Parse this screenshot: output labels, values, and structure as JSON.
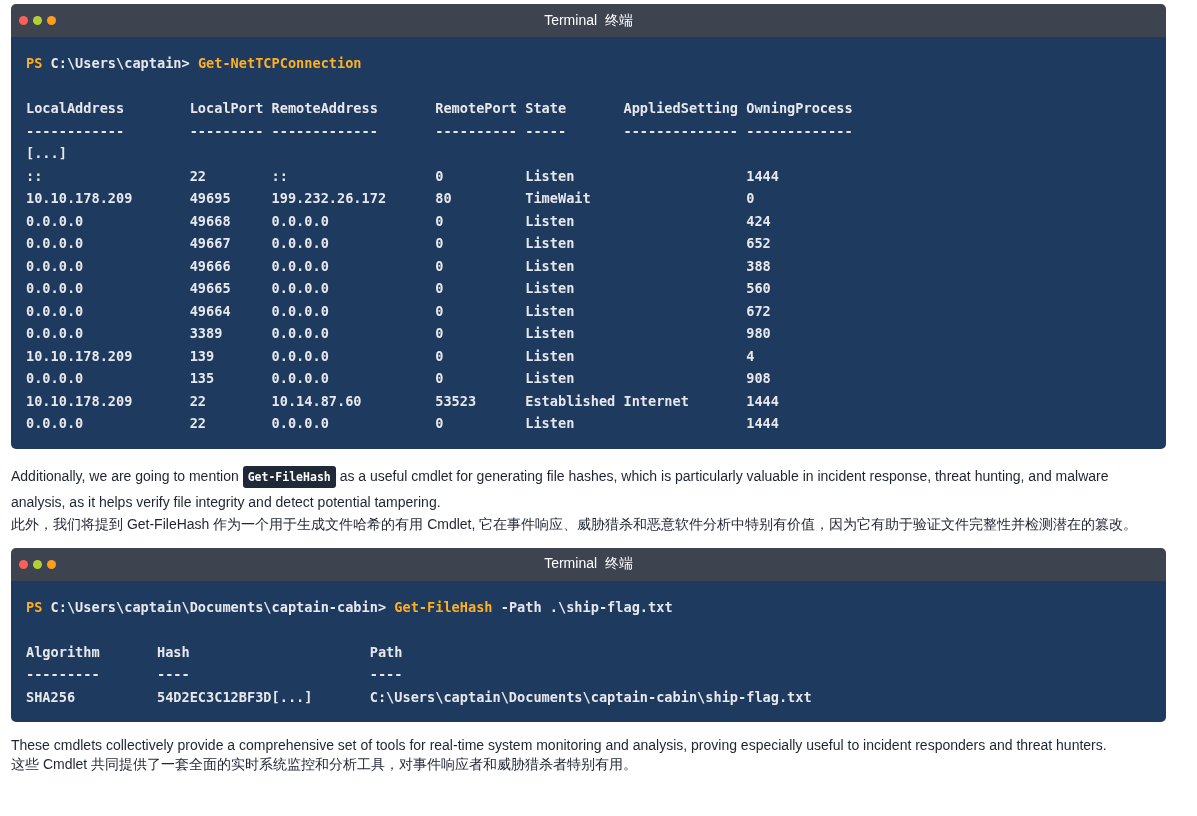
{
  "blocks": [
    {
      "kind": "terminal",
      "title": "Terminal  终端",
      "lines": [
        {
          "kind": "command",
          "parts": [
            {
              "kind": "ps",
              "text": "PS"
            },
            {
              "kind": "path",
              "text": " C:\\Users\\captain> "
            },
            {
              "kind": "cmd",
              "text": "Get-NetTCPConnection"
            }
          ]
        },
        {
          "kind": "blank"
        },
        {
          "kind": "output",
          "text": "LocalAddress        LocalPort RemoteAddress       RemotePort State       AppliedSetting OwningProcess"
        },
        {
          "kind": "output",
          "text": "------------        --------- -------------       ---------- -----       -------------- -------------"
        },
        {
          "kind": "output",
          "text": "[...]"
        },
        {
          "kind": "output",
          "text": "::                  22        ::                  0          Listen                     1444"
        },
        {
          "kind": "output",
          "text": "10.10.178.209       49695     199.232.26.172      80         TimeWait                   0"
        },
        {
          "kind": "output",
          "text": "0.0.0.0             49668     0.0.0.0             0          Listen                     424"
        },
        {
          "kind": "output",
          "text": "0.0.0.0             49667     0.0.0.0             0          Listen                     652"
        },
        {
          "kind": "output",
          "text": "0.0.0.0             49666     0.0.0.0             0          Listen                     388"
        },
        {
          "kind": "output",
          "text": "0.0.0.0             49665     0.0.0.0             0          Listen                     560"
        },
        {
          "kind": "output",
          "text": "0.0.0.0             49664     0.0.0.0             0          Listen                     672"
        },
        {
          "kind": "output",
          "text": "0.0.0.0             3389      0.0.0.0             0          Listen                     980"
        },
        {
          "kind": "output",
          "text": "10.10.178.209       139       0.0.0.0             0          Listen                     4"
        },
        {
          "kind": "output",
          "text": "0.0.0.0             135       0.0.0.0             0          Listen                     908"
        },
        {
          "kind": "output",
          "text": "10.10.178.209       22        10.14.87.60         53523      Established Internet       1444"
        },
        {
          "kind": "output",
          "text": "0.0.0.0             22        0.0.0.0             0          Listen                     1444"
        }
      ]
    },
    {
      "kind": "paragraph",
      "parts": [
        {
          "kind": "text",
          "text": "Additionally, we are going to mention "
        },
        {
          "kind": "code",
          "text": "Get-FileHash"
        },
        {
          "kind": "text",
          "text": " as a useful cmdlet for generating file hashes, which is particularly valuable in incident response, threat hunting, and malware analysis, as it helps verify file integrity and detect potential tampering."
        }
      ]
    },
    {
      "kind": "paragraph",
      "parts": [
        {
          "kind": "text",
          "text": "此外，我们将提到 Get-FileHash 作为一个用于生成文件哈希的有用 Cmdlet, 它在事件响应、威胁猎杀和恶意软件分析中特别有价值，因为它有助于验证文件完整性并检测潜在的篡改。"
        }
      ]
    },
    {
      "kind": "terminal",
      "title": "Terminal  终端",
      "lines": [
        {
          "kind": "command",
          "parts": [
            {
              "kind": "ps",
              "text": "PS"
            },
            {
              "kind": "path",
              "text": " C:\\Users\\captain\\Documents\\captain-cabin> "
            },
            {
              "kind": "cmd",
              "text": "Get-FileHash"
            },
            {
              "kind": "path",
              "text": " -Path .\\ship-flag.txt"
            }
          ]
        },
        {
          "kind": "blank"
        },
        {
          "kind": "output",
          "text": "Algorithm       Hash                      Path"
        },
        {
          "kind": "output",
          "text": "---------       ----                      ----"
        },
        {
          "kind": "output",
          "text": "SHA256          54D2EC3C12BF3D[...]       C:\\Users\\captain\\Documents\\captain-cabin\\ship-flag.txt"
        }
      ]
    },
    {
      "kind": "paragraph",
      "parts": [
        {
          "kind": "text",
          "text": "These cmdlets collectively provide a comprehensive set of tools for real-time system monitoring and analysis, proving especially useful to incident responders and threat hunters."
        }
      ]
    },
    {
      "kind": "paragraph",
      "parts": [
        {
          "kind": "text",
          "text": "这些 Cmdlet 共同提供了一套全面的实时系统监控和分析工具，对事件响应者和威胁猎杀者特别有用。"
        }
      ]
    }
  ]
}
